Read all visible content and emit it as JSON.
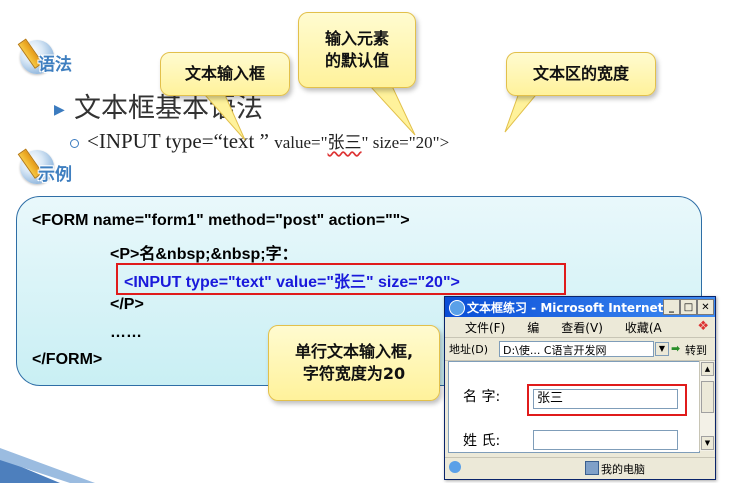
{
  "badges": {
    "syntax": "语法",
    "example": "示例"
  },
  "bullet_title": "文本框基本语法",
  "syntax_line": {
    "part1": "<INPUT  type=“text ” ",
    "part2": "value=\"",
    "value": "张三",
    "part3": "\"   size=\"20\">"
  },
  "callouts": {
    "text_input": "文本输入框",
    "default_value_line1": "输入元素",
    "default_value_line2": "的默认值",
    "text_width": "文本区的宽度",
    "single_line_1": "单行文本输入框,",
    "single_line_2": "字符宽度为20"
  },
  "code_lines": [
    "<FORM name=\"form1\" method=\"post\" action=\"\">",
    "<P>名&nbsp;&nbsp;字：",
    "<INPUT  type=\"text\" value=\"张三\" size=\"20\">",
    "</P>",
    "……",
    "</FORM>"
  ],
  "browser": {
    "title": "文本框练习 - Microsoft Internet E...",
    "menu": [
      "文件(F)",
      "编",
      "查看(V)",
      "收藏(A"
    ],
    "address_label": "地址(D)",
    "address_value": "D:\\使... C语言开发网",
    "go_label": "转到",
    "label_name": "名  字:",
    "value_name": "张三",
    "label_surname": "姓  氏:",
    "status_zone": "我的电脑"
  },
  "colors": {
    "panel_border": "#2e6ea6",
    "highlight_red": "#e01b1b",
    "code_blue": "#1a1adb"
  }
}
